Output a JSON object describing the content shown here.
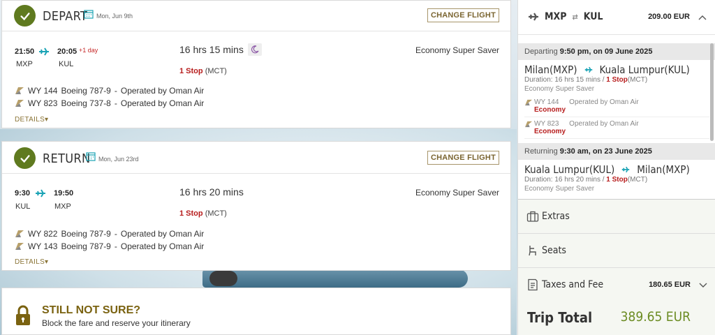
{
  "depart": {
    "title": "DEPART",
    "date": "Mon, Jun 9th",
    "change_label": "CHANGE FLIGHT",
    "dep_time": "21:50",
    "arr_time": "20:05",
    "plus_day": "+1 day",
    "from": "MXP",
    "to": "KUL",
    "duration": "16 hrs 15 mins",
    "stops": "1 Stop",
    "via": "(MCT)",
    "cabin": "Economy Super Saver",
    "segments": [
      {
        "flight": "WY 144",
        "aircraft": "Boeing 787-9",
        "operator": "Operated by Oman Air"
      },
      {
        "flight": "WY 823",
        "aircraft": "Boeing 737-8",
        "operator": "Operated by Oman Air"
      }
    ],
    "details_label": "DETAILS"
  },
  "return": {
    "title": "RETURN",
    "date": "Mon, Jun 23rd",
    "change_label": "CHANGE FLIGHT",
    "dep_time": "9:30",
    "arr_time": "19:50",
    "from": "KUL",
    "to": "MXP",
    "duration": "16 hrs 20 mins",
    "stops": "1 Stop",
    "via": "(MCT)",
    "cabin": "Economy Super Saver",
    "segments": [
      {
        "flight": "WY 822",
        "aircraft": "Boeing 787-9",
        "operator": "Operated by Oman Air"
      },
      {
        "flight": "WY 143",
        "aircraft": "Boeing 787-9",
        "operator": "Operated by Oman Air"
      }
    ],
    "details_label": "DETAILS"
  },
  "unsure": {
    "title": "STILL NOT SURE?",
    "subtitle": "Block the fare and reserve your itinerary"
  },
  "summary": {
    "origin": "MXP",
    "destination": "KUL",
    "price": "209.00 EUR",
    "outbound": {
      "label": "Departing",
      "when": "9:50 pm, on 09 June 2025",
      "from": "Milan(MXP)",
      "to": "Kuala Lumpur(KUL)",
      "duration": "Duration: 16 hrs 15 mins /",
      "stops": "1 Stop",
      "via": "(MCT)",
      "cabin": "Economy Super Saver",
      "flights": [
        {
          "flight": "WY 144",
          "operator": "Operated by Oman Air",
          "class": "Economy"
        },
        {
          "flight": "WY 823",
          "operator": "Operated by Oman Air",
          "class": "Economy"
        }
      ]
    },
    "inbound": {
      "label": "Returning",
      "when": "9:30 am, on 23 June 2025",
      "from": "Kuala Lumpur(KUL)",
      "to": "Milan(MXP)",
      "duration": "Duration: 16 hrs 20 mins /",
      "stops": "1 Stop",
      "via": "(MCT)",
      "cabin": "Economy Super Saver"
    },
    "extras_label": "Extras",
    "seats_label": "Seats",
    "taxes_label": "Taxes and Fee",
    "taxes_amount": "180.65 EUR",
    "total_label": "Trip Total",
    "total_amount": "389.65 EUR"
  },
  "colors": {
    "brand_green": "#5f7a1f",
    "gold": "#7a6430",
    "stop_red": "#b71c1c",
    "teal_plane": "#1aa3b5"
  }
}
